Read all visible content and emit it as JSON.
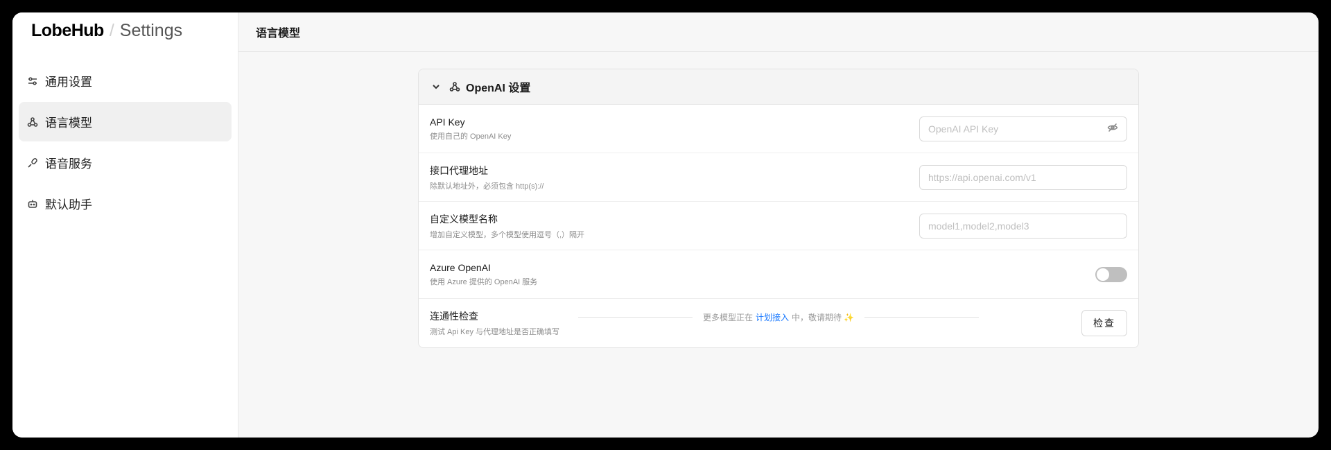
{
  "brand": {
    "logo": "LobeHub",
    "separator": "/",
    "subtitle": "Settings"
  },
  "sidebar": {
    "items": [
      {
        "label": "通用设置",
        "icon": "settings-sliders-icon",
        "active": false
      },
      {
        "label": "语言模型",
        "icon": "webhook-icon",
        "active": true
      },
      {
        "label": "语音服务",
        "icon": "microphone-icon",
        "active": false
      },
      {
        "label": "默认助手",
        "icon": "bot-icon",
        "active": false
      }
    ]
  },
  "header": {
    "title": "语言模型"
  },
  "card": {
    "title": "OpenAI 设置",
    "rows": [
      {
        "label": "API Key",
        "desc": "使用自己的 OpenAI Key",
        "placeholder": "OpenAI API Key"
      },
      {
        "label": "接口代理地址",
        "desc": "除默认地址外，必须包含 http(s)://",
        "placeholder": "https://api.openai.com/v1"
      },
      {
        "label": "自定义模型名称",
        "desc": "增加自定义模型，多个模型使用逗号（,）隔开",
        "placeholder": "model1,model2,model3"
      },
      {
        "label": "Azure OpenAI",
        "desc": "使用 Azure 提供的 OpenAI 服务",
        "toggle_on": false
      },
      {
        "label": "连通性检查",
        "desc": "测试 Api Key 与代理地址是否正确填写",
        "button": "检查"
      }
    ]
  },
  "footer": {
    "before": "更多模型正在",
    "link": "计划接入",
    "after": "中，敬请期待",
    "emoji": "✨"
  },
  "colors": {
    "accent": "#1677ff",
    "toggle_off": "#bfbfbf"
  }
}
